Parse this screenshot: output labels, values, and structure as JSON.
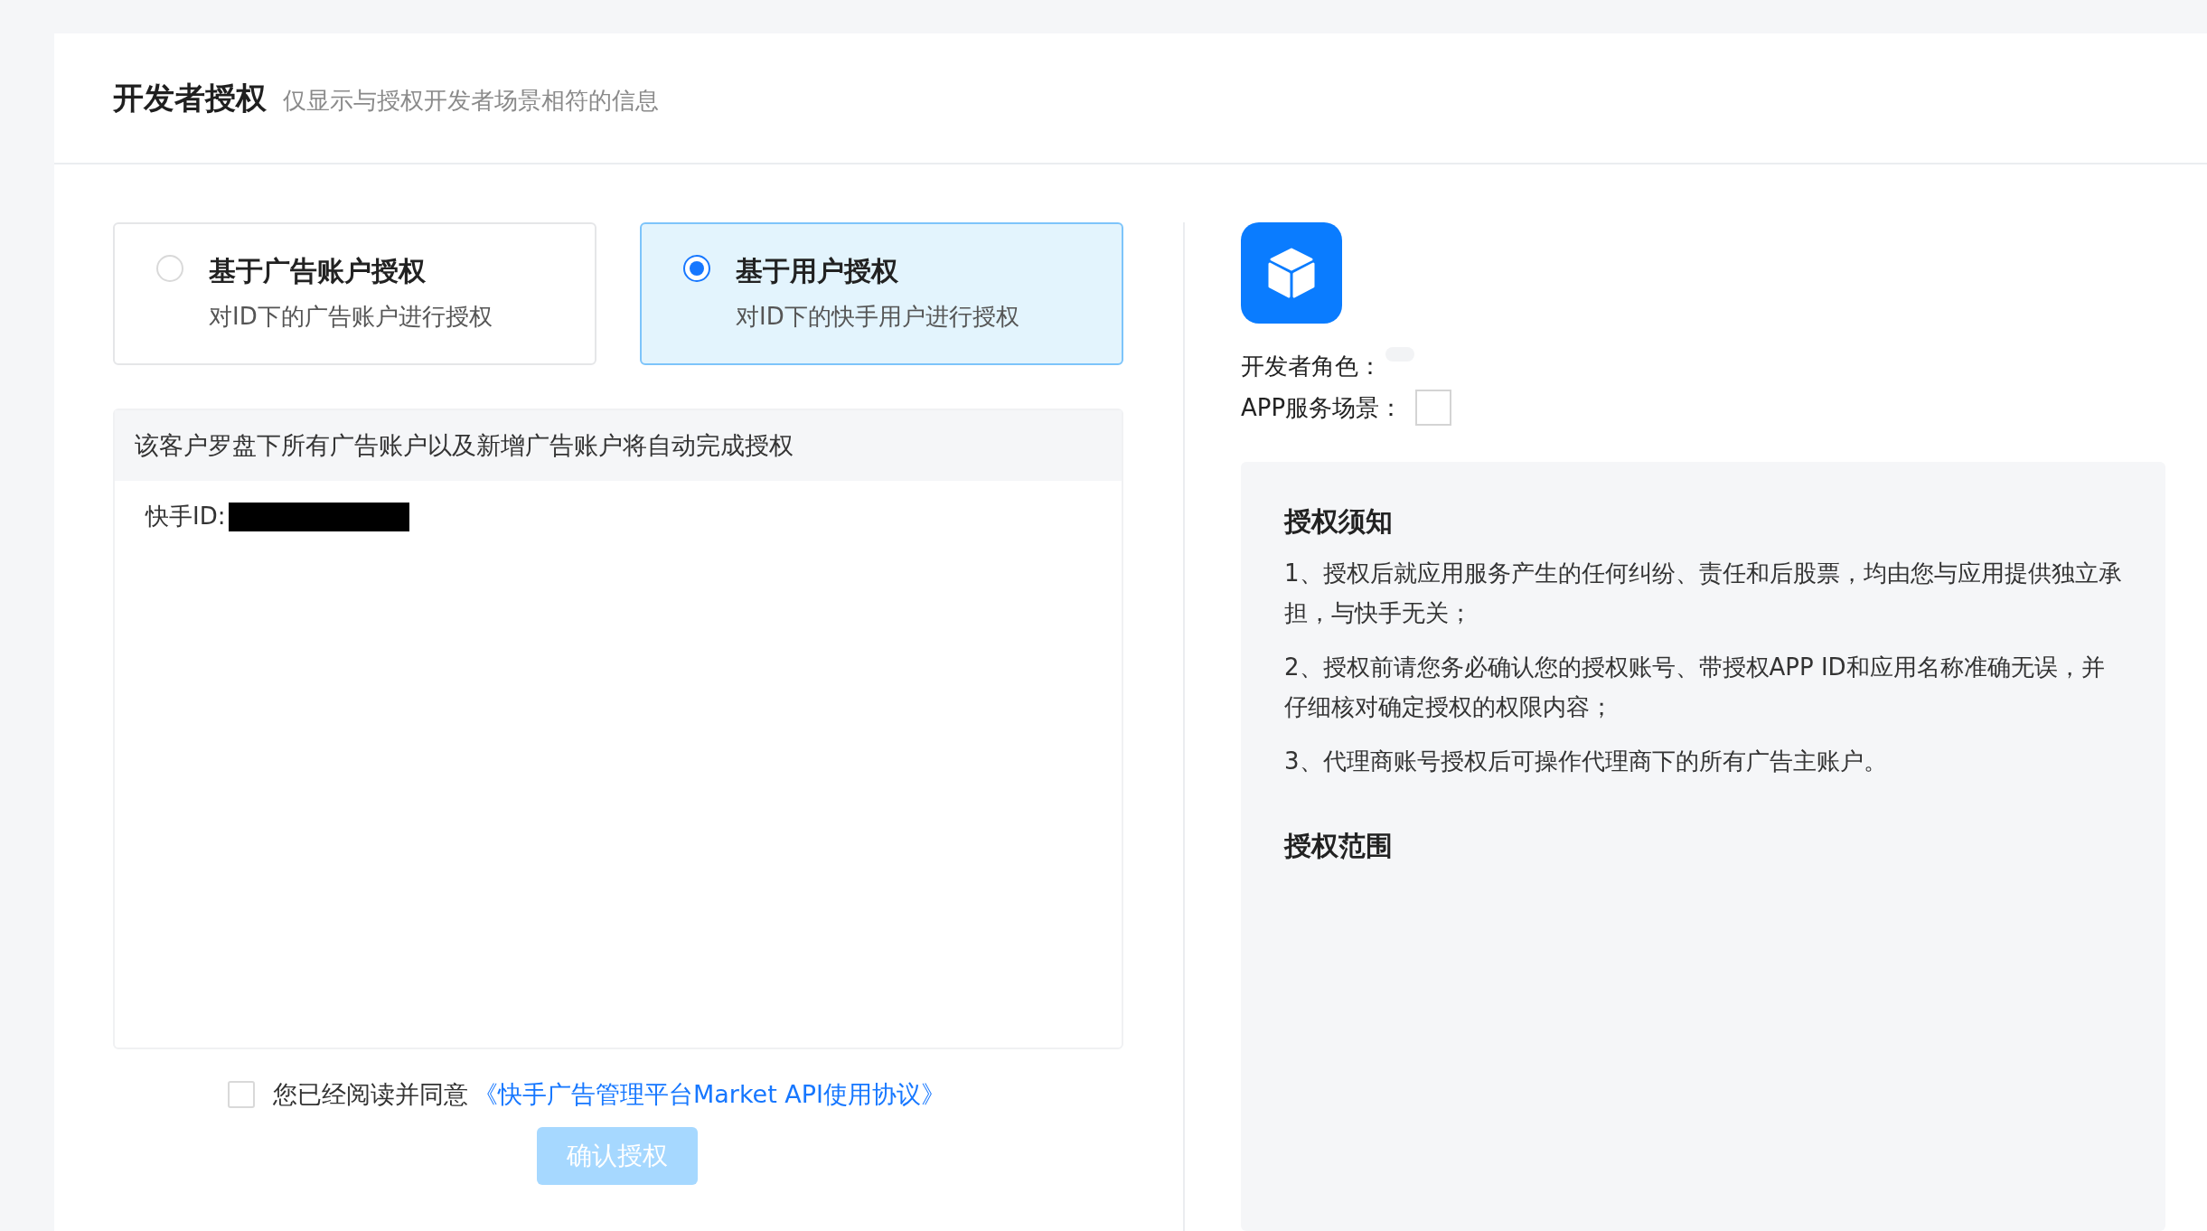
{
  "header": {
    "title": "开发者授权",
    "subtitle": "仅显示与授权开发者场景相符的信息"
  },
  "auth_options": [
    {
      "title": "基于广告账户授权",
      "description": "对ID下的广告账户进行授权",
      "selected": false
    },
    {
      "title": "基于用户授权",
      "description": "对ID下的快手用户进行授权",
      "selected": true
    }
  ],
  "info_box": {
    "notice": "该客户罗盘下所有广告账户以及新增广告账户将自动完成授权",
    "id_label": "快手ID:"
  },
  "agreement": {
    "checked": false,
    "text": "您已经阅读并同意",
    "link": "《快手广告管理平台Market API使用协议》"
  },
  "confirm_button": {
    "label": "确认授权",
    "disabled": true
  },
  "app_info": {
    "fields": [
      {
        "label": "开发者角色：",
        "kind": "tag"
      },
      {
        "label": "APP服务场景：",
        "kind": "box"
      }
    ]
  },
  "notes": {
    "title": "授权须知",
    "items": [
      "1、授权后就应用服务产生的任何纠纷、责任和后股票，均由您与应用提供独立承担，与快手无关；",
      "2、授权前请您务必确认您的授权账号、带授权APP ID和应用名称准确无误，并仔细核对确定授权的权限内容；",
      "3、代理商账号授权后可操作代理商下的所有广告主账户。"
    ]
  },
  "scope": {
    "title": "授权范围"
  }
}
